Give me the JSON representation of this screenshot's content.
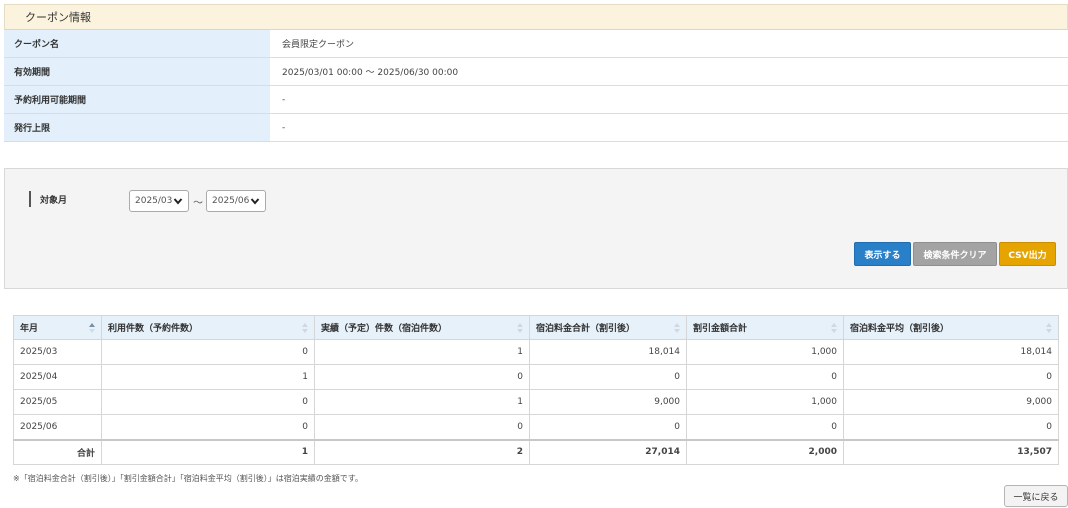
{
  "coupon_info": {
    "header": "クーポン情報",
    "rows": [
      {
        "label": "クーポン名",
        "value": "会員限定クーポン"
      },
      {
        "label": "有効期間",
        "value": "2025/03/01 00:00 〜 2025/06/30 00:00"
      },
      {
        "label": "予約利用可能期間",
        "value": "-"
      },
      {
        "label": "発行上限",
        "value": "-"
      }
    ]
  },
  "search": {
    "month_label": "対象月",
    "from_value": "2025/03",
    "separator": "〜",
    "to_value": "2025/06",
    "show_label": "表示する",
    "clear_label": "検索条件クリア",
    "csv_label": "CSV出力"
  },
  "table": {
    "headers": [
      "年月",
      "利用件数（予約件数）",
      "実績（予定）件数（宿泊件数）",
      "宿泊料金合計（割引後）",
      "割引金額合計",
      "宿泊料金平均（割引後）"
    ],
    "rows": [
      [
        "2025/03",
        "0",
        "1",
        "18,014",
        "1,000",
        "18,014"
      ],
      [
        "2025/04",
        "1",
        "0",
        "0",
        "0",
        "0"
      ],
      [
        "2025/05",
        "0",
        "1",
        "9,000",
        "1,000",
        "9,000"
      ],
      [
        "2025/06",
        "0",
        "0",
        "0",
        "0",
        "0"
      ]
    ],
    "total": [
      "合計",
      "1",
      "2",
      "27,014",
      "2,000",
      "13,507"
    ]
  },
  "note": "※「宿泊料金合計（割引後）」「割引金額合計」「宿泊料金平均（割引後）」は宿泊実績の金額です。",
  "back_label": "一覧に戻る",
  "colors": {
    "show_button": "#2a7fc9",
    "clear_button": "#a3a3a3",
    "csv_button": "#e5a400",
    "header_bg": "#fbf3dd",
    "label_bg": "#e3f0fb"
  }
}
